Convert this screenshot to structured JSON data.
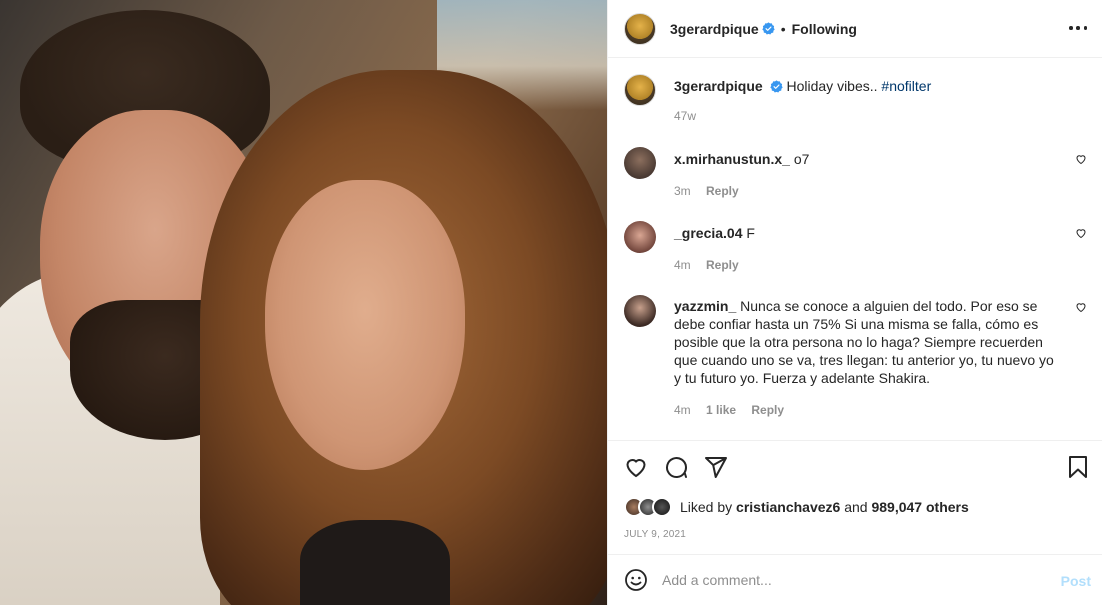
{
  "post": {
    "author": "3gerardpique",
    "follow_status": "Following",
    "separator": "•",
    "caption_text": "Holiday vibes..",
    "caption_tag": "#nofilter",
    "caption_time": "47w"
  },
  "comments": [
    {
      "user": "x.mirhanustun.x_",
      "text": "o7",
      "time": "3m",
      "likes": "",
      "reply_label": "Reply"
    },
    {
      "user": "_grecia.04",
      "text": "F",
      "time": "4m",
      "likes": "",
      "reply_label": "Reply"
    },
    {
      "user": "yazzmin_",
      "text": "Nunca se conoce a alguien del todo. Por eso se debe confiar hasta un 75% Si una misma se falla, cómo es posible que la otra persona no lo haga? Siempre recuerden que cuando uno se va, tres llegan: tu anterior yo, tu nuevo yo y tu futuro yo. Fuerza y adelante Shakira.",
      "time": "4m",
      "likes": "1 like",
      "reply_label": "Reply"
    }
  ],
  "likes": {
    "prefix": "Liked by",
    "user": "cristianchavez6",
    "conj": "and",
    "count": "989,047 others"
  },
  "date": "JULY 9, 2021",
  "add_comment": {
    "placeholder": "Add a comment...",
    "post_label": "Post"
  },
  "icons": {
    "verified": "verified-badge-icon",
    "more": "more-options-icon",
    "like": "heart-icon",
    "comment": "comment-icon",
    "share": "send-icon",
    "save": "bookmark-icon",
    "emoji": "emoji-icon"
  },
  "colors": {
    "verified_blue": "#3897f0",
    "link_blue": "#00376b",
    "post_button": "#b2dffc",
    "muted": "#8e8e8e"
  }
}
